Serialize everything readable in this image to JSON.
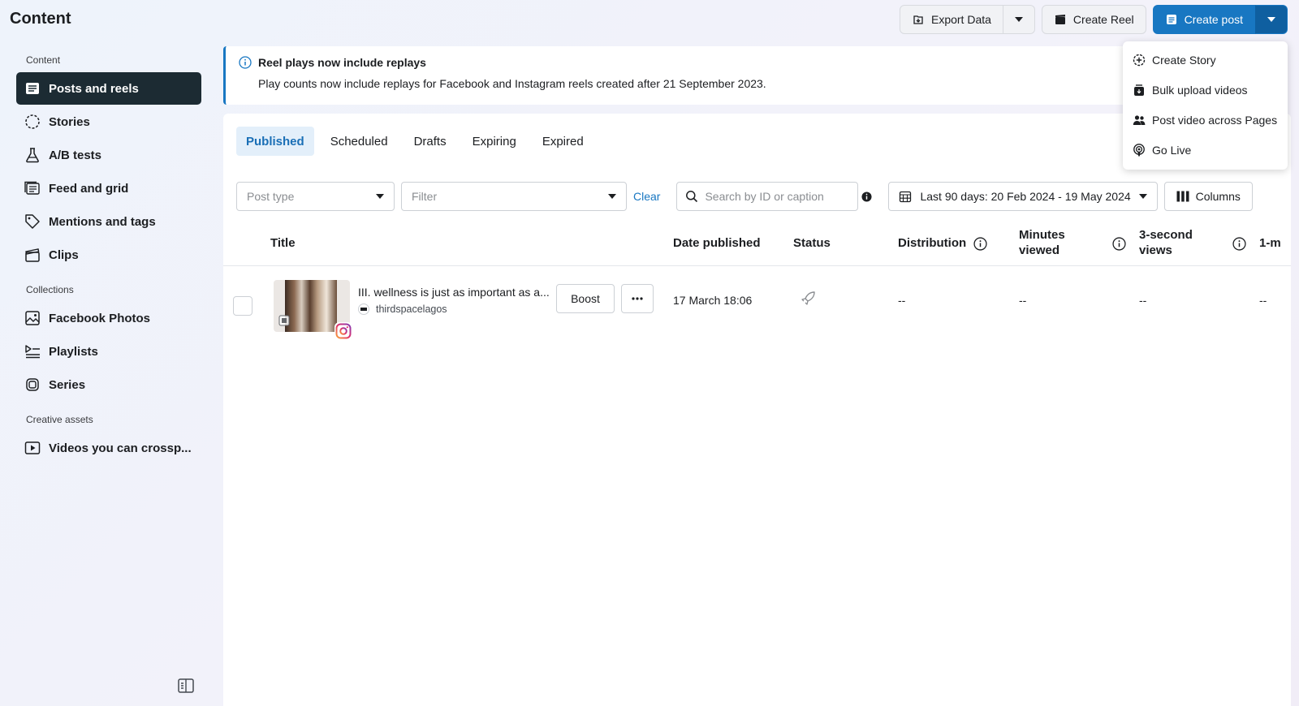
{
  "page_title": "Content",
  "toolbar": {
    "export_label": "Export Data",
    "create_reel_label": "Create Reel",
    "create_post_label": "Create post"
  },
  "create_menu": {
    "items": [
      {
        "label": "Create Story",
        "icon": "plus-circle-icon"
      },
      {
        "label": "Bulk upload videos",
        "icon": "stack-icon"
      },
      {
        "label": "Post video across Pages",
        "icon": "people-icon"
      },
      {
        "label": "Go Live",
        "icon": "live-icon"
      }
    ]
  },
  "sidebar": {
    "section_content": "Content",
    "content_items": [
      {
        "label": "Posts and reels",
        "icon": "posts-icon",
        "active": true
      },
      {
        "label": "Stories",
        "icon": "stories-icon"
      },
      {
        "label": "A/B tests",
        "icon": "flask-icon"
      },
      {
        "label": "Feed and grid",
        "icon": "feed-grid-icon"
      },
      {
        "label": "Mentions and tags",
        "icon": "tag-icon"
      },
      {
        "label": "Clips",
        "icon": "clapper-icon"
      }
    ],
    "section_collections": "Collections",
    "collection_items": [
      {
        "label": "Facebook Photos",
        "icon": "photo-icon"
      },
      {
        "label": "Playlists",
        "icon": "playlist-icon"
      },
      {
        "label": "Series",
        "icon": "series-icon"
      }
    ],
    "section_creative": "Creative assets",
    "creative_items": [
      {
        "label": "Videos you can crossp...",
        "icon": "video-play-icon"
      }
    ]
  },
  "banner": {
    "title": "Reel plays now include replays",
    "text": "Play counts now include replays for Facebook and Instagram reels created after 21 September 2023."
  },
  "tabs": [
    "Published",
    "Scheduled",
    "Drafts",
    "Expiring",
    "Expired"
  ],
  "active_tab": "Published",
  "filters": {
    "post_type_placeholder": "Post type",
    "filter_placeholder": "Filter",
    "clear_label": "Clear",
    "search_placeholder": "Search by ID or caption",
    "date_range": "Last 90 days: 20 Feb 2024 - 19 May 2024",
    "columns_label": "Columns"
  },
  "table": {
    "headers": {
      "title": "Title",
      "date": "Date published",
      "status": "Status",
      "distribution": "Distribution",
      "minutes_1": "Minutes",
      "minutes_2": "viewed",
      "views_1": "3-second",
      "views_2": "views",
      "next": "1-m"
    },
    "rows": [
      {
        "caption": "III. wellness is just as important as a...",
        "account": "thirdspacelagos",
        "boost_label": "Boost",
        "date": "17 March 18:06",
        "distribution": "--",
        "minutes_viewed": "--",
        "views": "--",
        "next": "--"
      }
    ]
  },
  "colors": {
    "accent": "#1877c2",
    "sidebar_active": "#1c2b33",
    "tab_active_bg": "#e3effa"
  }
}
